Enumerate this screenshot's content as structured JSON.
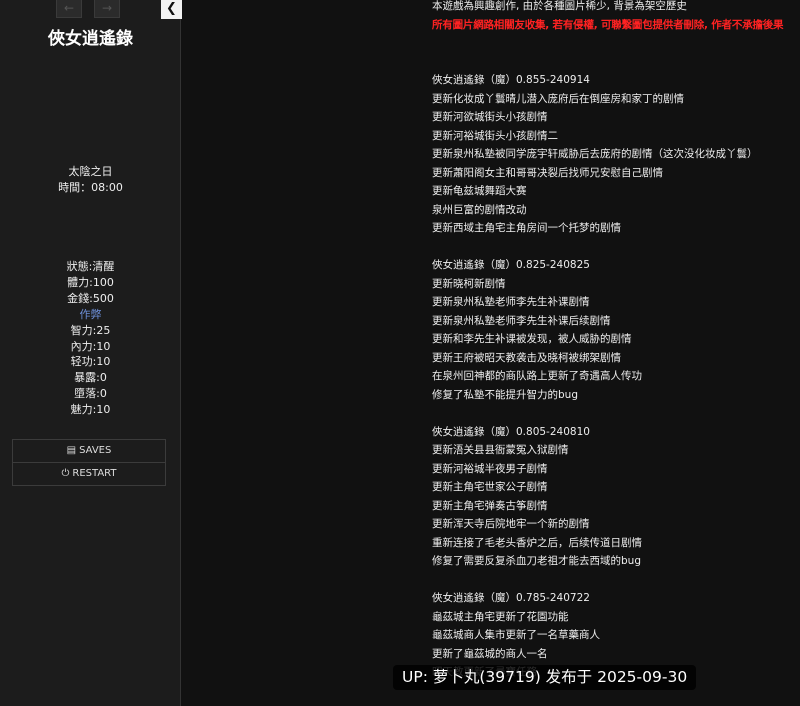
{
  "sidebar": {
    "back_icon": "←",
    "forward_icon": "→",
    "toggle_icon": "❮",
    "title": "俠女逍遙錄",
    "time_of_day": "太陰之日",
    "time": "時間：08:00",
    "stats": [
      "狀態:清醒",
      "體力:100",
      "金錢:500",
      "作弊",
      "智力:25",
      "內力:10",
      "轻功:10",
      "暴露:0",
      "墮落:0",
      "魅力:10"
    ],
    "saves_label": "SAVES",
    "restart_label": "RESTART",
    "saves_icon": "▤",
    "restart_icon": "⏻"
  },
  "passage": {
    "intro": "本遊戲為興趣創作, 由於各種圖片稀少, 背景為架空歷史",
    "warning": "所有圖片網路相關友收集, 若有侵權, 可聯繫圖包提供者刪除, 作者不承擔後果",
    "sections": [
      {
        "version": "俠女逍遙錄（魔）0.855-240914",
        "lines": [
          "更新化妆成丫鬟晴儿潜入庞府后在倒座房和家丁的剧情",
          "更新河欲城街头小孩剧情",
          "更新河裕城街头小孩剧情二",
          "更新泉州私塾被同学庞宇轩威胁后去庞府的剧情（这次没化妆成丫鬟）",
          "更新蕭阳阁女主和哥哥决裂后找师兄安慰自己剧情",
          "更新龟兹城舞蹈大赛",
          "泉州巨富的剧情改动",
          "更新西域主角宅主角房间一个托梦的剧情"
        ]
      },
      {
        "version": "俠女逍遙錄（魔）0.825-240825",
        "lines": [
          "更新晓柯新剧情",
          "更新泉州私塾老师李先生补课剧情",
          "更新泉州私塾老师李先生补课后续剧情",
          "更新和李先生补课被发现，被人威胁的剧情",
          "更新王府被昭天教袭击及晓柯被绑架剧情",
          "在泉州回神都的商队路上更新了奇遇高人传功",
          "修复了私塾不能提升智力的bug"
        ]
      },
      {
        "version": "俠女逍遙錄（魔）0.805-240810",
        "lines": [
          "更新浯关县县衙蒙冤入狱剧情",
          "更新河裕城半夜男子剧情",
          "更新主角宅世家公子剧情",
          "更新主角宅弹奏古筝剧情",
          "更新浑天寺后院地牢一个新的剧情",
          "重新连接了毛老头香炉之后，后续传道日剧情",
          "修复了需要反复杀血刀老祖才能去西域的bug"
        ]
      },
      {
        "version": "俠女逍遙錄（魔）0.785-240722",
        "lines": [
          "龜茲城主角宅更新了花園功能",
          "龜茲城商人集市更新了一名草藥商人",
          "更新了龜茲城的商人一名",
          "昭天教更新了尋寶任務"
        ]
      }
    ]
  },
  "watermark": {
    "text": "UP: 萝卜丸(39719) 发布于 2025-09-30"
  },
  "colors": {
    "background": "#111111",
    "sidebar": "#1c1c1c",
    "warning": "#ff2222",
    "link": "#6d8fd8"
  }
}
